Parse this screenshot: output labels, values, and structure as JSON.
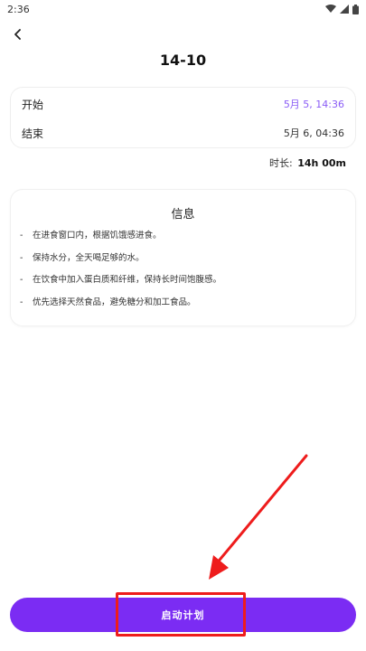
{
  "status": {
    "time": "2:36"
  },
  "page": {
    "title": "14-10"
  },
  "schedule": {
    "start_label": "开始",
    "start_value": "5月 5, 14:36",
    "end_label": "结束",
    "end_value": "5月 6, 04:36",
    "duration_label": "时长:",
    "duration_value": "14h 00m"
  },
  "info": {
    "title": "信息",
    "tips": [
      "在进食窗口内，根据饥饿感进食。",
      "保持水分，全天喝足够的水。",
      "在饮食中加入蛋白质和纤维，保持长时间饱腹感。",
      "优先选择天然食品，避免糖分和加工食品。"
    ]
  },
  "action": {
    "start_plan_label": "启动计划"
  },
  "colors": {
    "accent": "#7b2cf3",
    "accent_text": "#8a5cf6",
    "highlight": "#ee1c1c"
  }
}
